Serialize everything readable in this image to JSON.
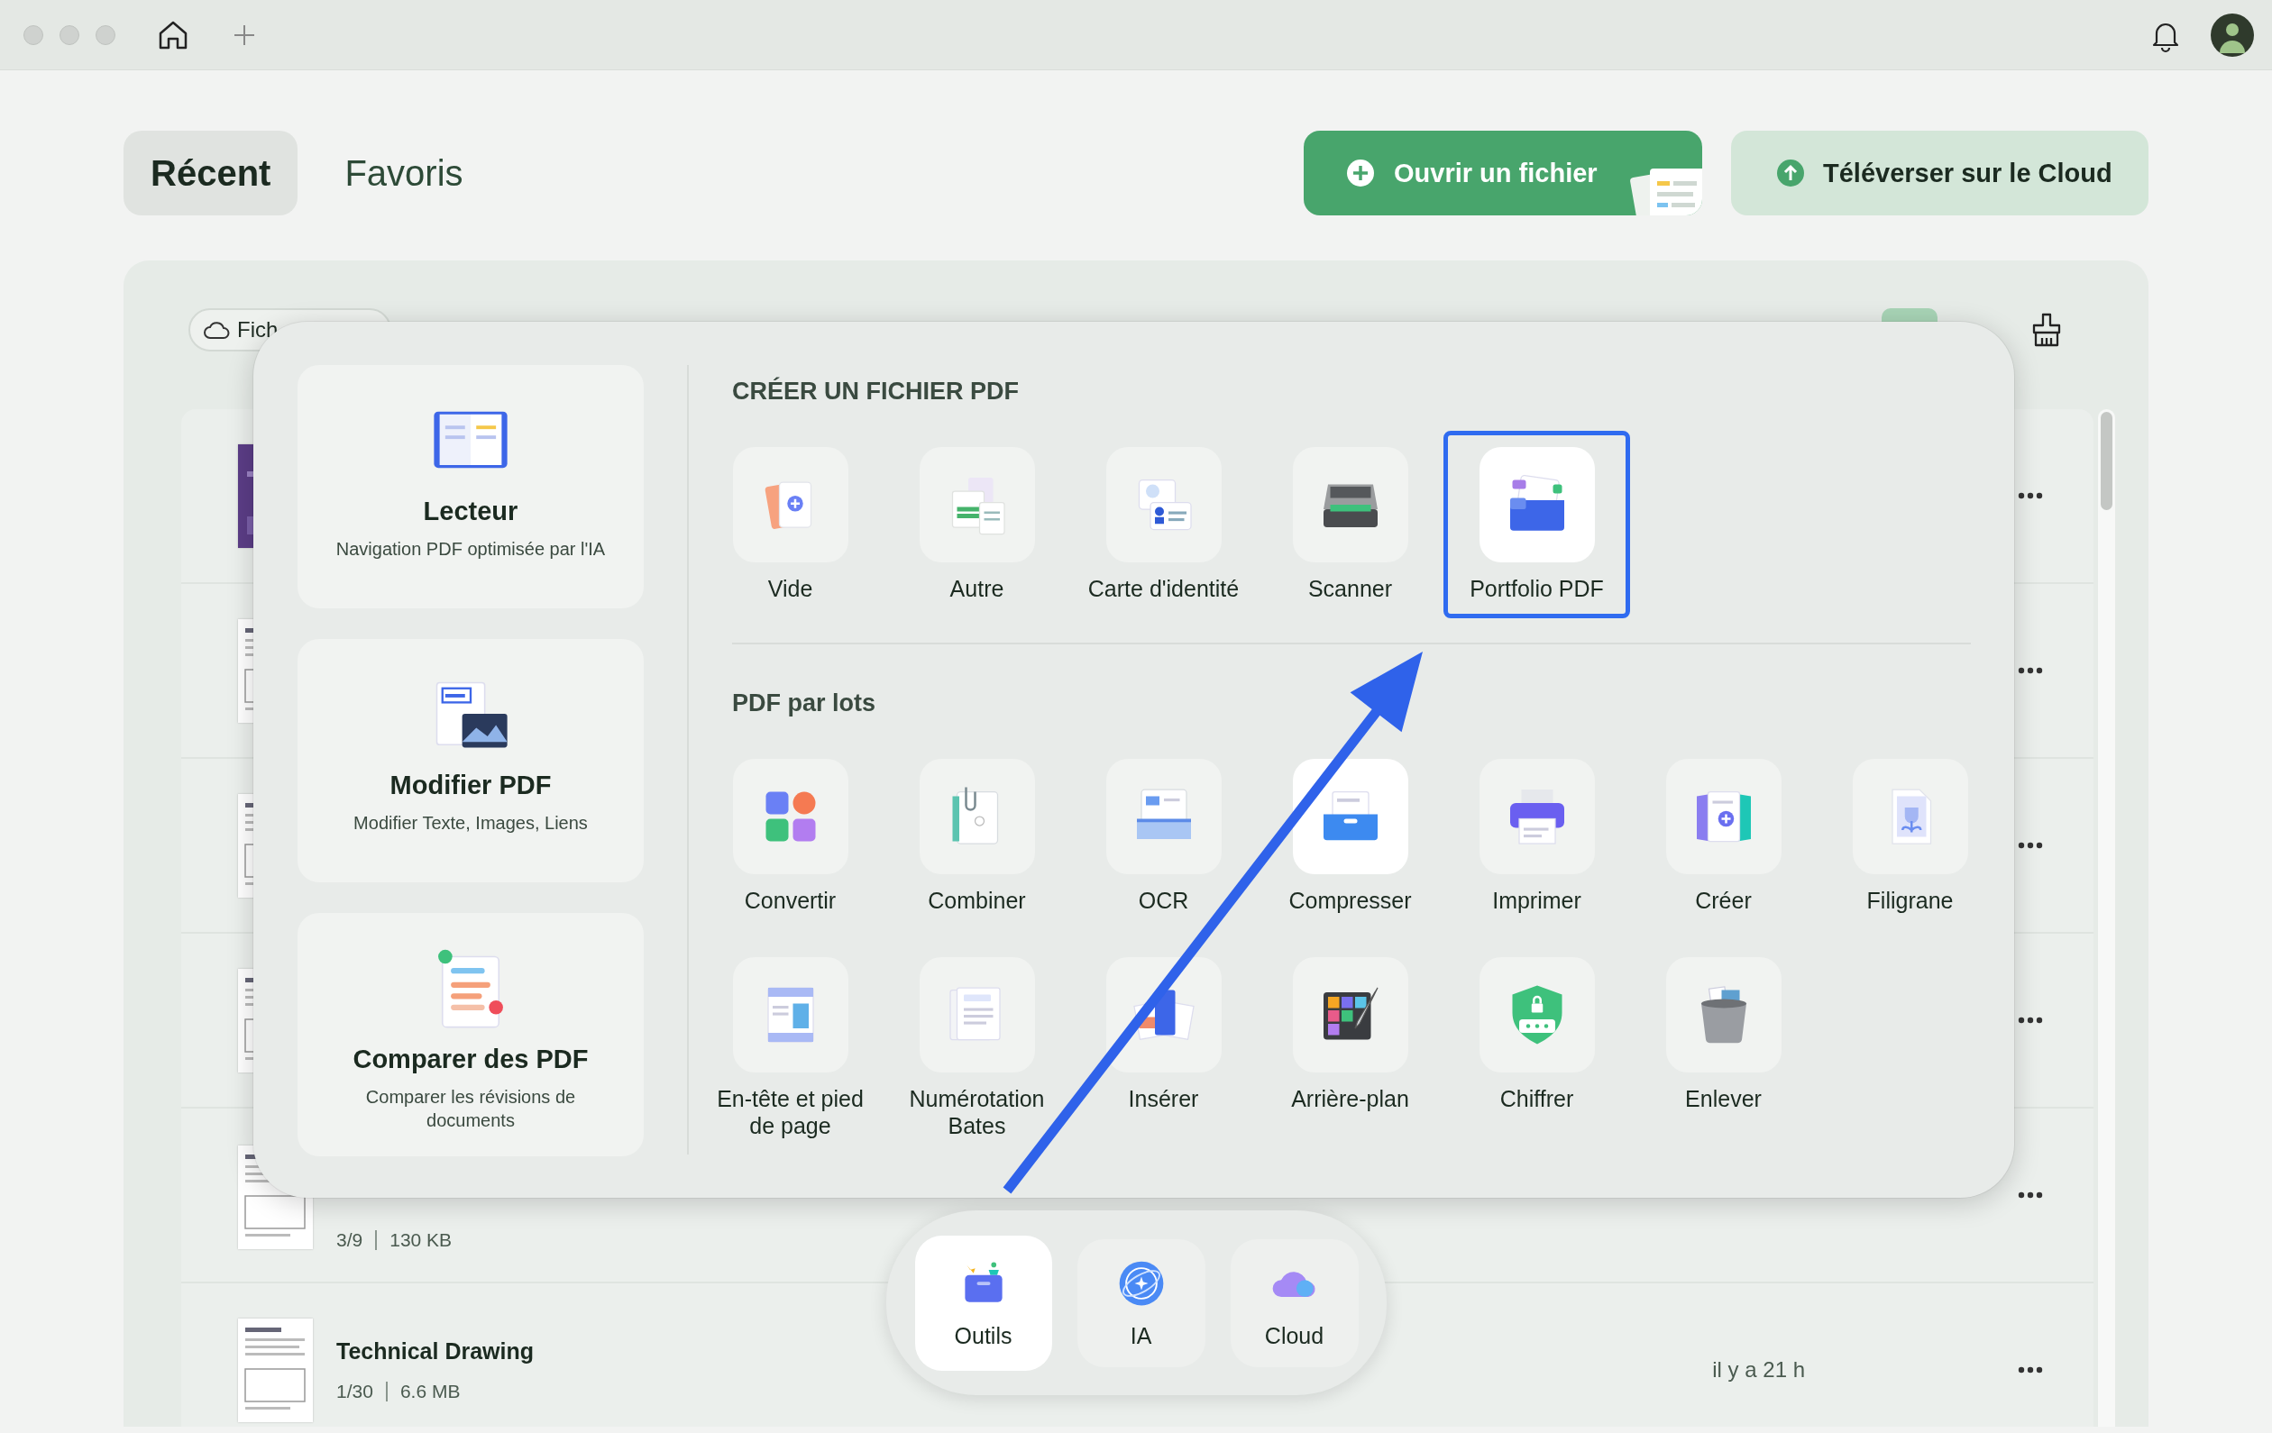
{
  "header": {
    "tabs": [
      {
        "label": "Récent",
        "selected": true
      },
      {
        "label": "Favoris",
        "selected": false
      }
    ],
    "actions": [
      {
        "label": "Ouvrir un fichier",
        "kind": "primary"
      },
      {
        "label": "Téléverser sur le Cloud",
        "kind": "secondary"
      }
    ]
  },
  "file_panel": {
    "filter": "Fich",
    "rows": [
      {
        "kind": "covered"
      },
      {
        "kind": "covered"
      },
      {
        "kind": "covered"
      },
      {
        "kind": "covered"
      },
      {
        "kind": "partial",
        "pages": "3/9",
        "size": "130 KB"
      },
      {
        "kind": "full",
        "name": "Technical Drawing",
        "pages": "1/30",
        "size": "6.6 MB",
        "time": "il y a 21 h"
      }
    ]
  },
  "tools_popup": {
    "cards": [
      {
        "title": "Lecteur",
        "subtitle": "Navigation PDF optimisée par l'IA"
      },
      {
        "title": "Modifier PDF",
        "subtitle": "Modifier Texte, Images, Liens"
      },
      {
        "title": "Comparer des PDF",
        "subtitle": "Comparer les révisions de documents"
      }
    ],
    "sections": [
      {
        "heading": "CRÉER UN FICHIER PDF",
        "items": [
          {
            "label": "Vide",
            "selected": false
          },
          {
            "label": "Autre",
            "selected": false
          },
          {
            "label": "Carte d'identité",
            "selected": false
          },
          {
            "label": "Scanner",
            "selected": false
          },
          {
            "label": "Portfolio PDF",
            "selected": true
          }
        ]
      },
      {
        "heading": "PDF par lots",
        "items": [
          {
            "label": "Convertir",
            "hovered": false
          },
          {
            "label": "Combiner",
            "hovered": false
          },
          {
            "label": "OCR",
            "hovered": false
          },
          {
            "label": "Compresser",
            "hovered": true
          },
          {
            "label": "Imprimer",
            "hovered": false
          },
          {
            "label": "Créer",
            "hovered": false
          },
          {
            "label": "Filigrane",
            "hovered": false
          },
          {
            "label": "En-tête et pied de page",
            "hovered": false
          },
          {
            "label": "Numérotation Bates",
            "hovered": false
          },
          {
            "label": "Insérer",
            "hovered": false
          },
          {
            "label": "Arrière-plan",
            "hovered": false
          },
          {
            "label": "Chiffrer",
            "hovered": false
          },
          {
            "label": "Enlever",
            "hovered": false
          }
        ]
      }
    ]
  },
  "dock": {
    "items": [
      {
        "label": "Outils",
        "selected": true
      },
      {
        "label": "IA",
        "selected": false
      },
      {
        "label": "Cloud",
        "selected": false
      }
    ]
  }
}
